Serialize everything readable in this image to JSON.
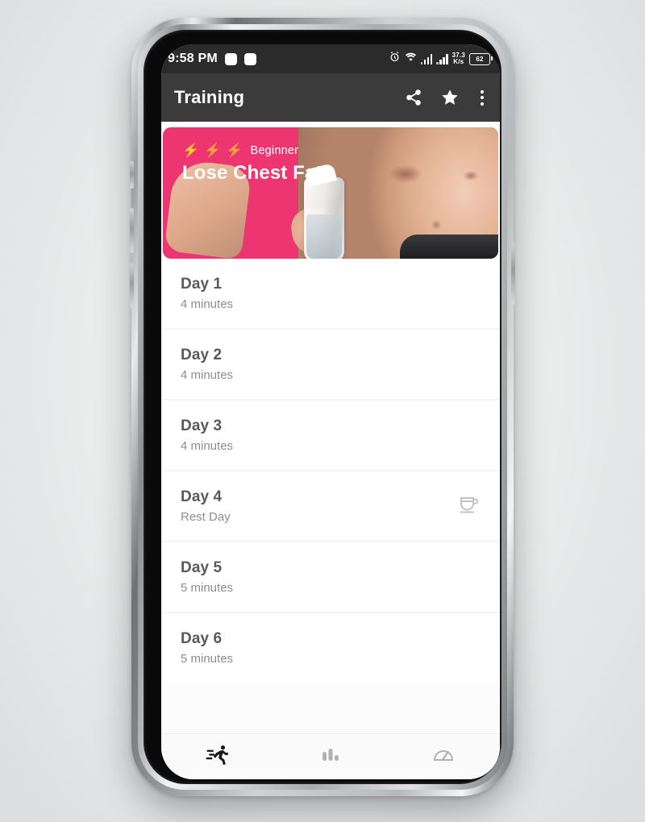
{
  "status_bar": {
    "time": "9:58 PM",
    "notification_icons": [
      "notification-square-icon",
      "notification-square-icon"
    ],
    "alarm_icon": "alarm-icon",
    "wifi_icon": "wifi-icon",
    "signal_icon_1": "signal-bars-icon",
    "signal_icon_2": "signal-bars-icon",
    "network_speed_value": "37.3",
    "network_speed_unit": "K/s",
    "battery_level": "62",
    "background_color": "#2b2b2b"
  },
  "app_bar": {
    "title": "Training",
    "background_color": "#3b3b3b",
    "actions": [
      {
        "name": "share-button",
        "icon": "share-icon"
      },
      {
        "name": "favorite-button",
        "icon": "star-icon"
      },
      {
        "name": "overflow-menu-button",
        "icon": "more-vertical-icon"
      }
    ]
  },
  "banner": {
    "level_label": "Beginner",
    "title": "Lose Chest Fat",
    "difficulty_bolts": 3,
    "accent_color": "#ec3571"
  },
  "day_list": [
    {
      "title": "Day 1",
      "subtitle": "4 minutes",
      "icon": null
    },
    {
      "title": "Day 2",
      "subtitle": "4 minutes",
      "icon": null
    },
    {
      "title": "Day 3",
      "subtitle": "4 minutes",
      "icon": null
    },
    {
      "title": "Day 4",
      "subtitle": "Rest Day",
      "icon": "coffee-cup-icon"
    },
    {
      "title": "Day 5",
      "subtitle": "5 minutes",
      "icon": null
    },
    {
      "title": "Day 6",
      "subtitle": "5 minutes",
      "icon": null
    }
  ],
  "tab_bar": {
    "tabs": [
      {
        "name": "tab-training",
        "icon": "running-person-icon",
        "active": true
      },
      {
        "name": "tab-report",
        "icon": "bar-chart-icon",
        "active": false
      },
      {
        "name": "tab-tools",
        "icon": "speedometer-icon",
        "active": false
      }
    ],
    "active_color": "#191919",
    "inactive_color": "#b0b1b3"
  },
  "system_nav": {
    "buttons": [
      {
        "name": "nav-recent-apps-button",
        "icon": "square-icon"
      },
      {
        "name": "nav-home-button",
        "icon": "circle-icon"
      },
      {
        "name": "nav-back-button",
        "icon": "triangle-back-icon"
      }
    ]
  }
}
